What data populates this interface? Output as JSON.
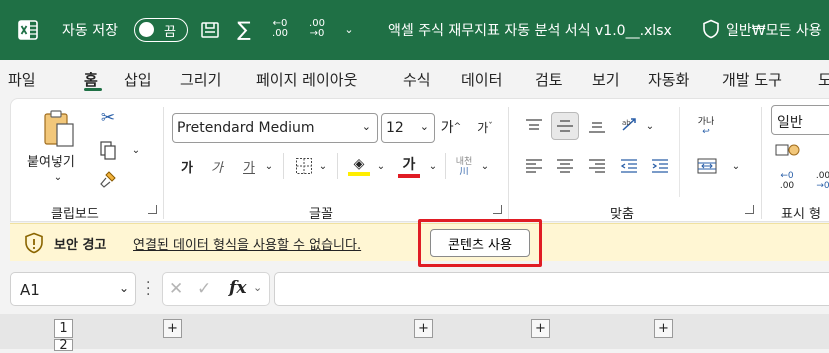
{
  "titlebar": {
    "autosave_label": "자동 저장",
    "autosave_state": "끔",
    "file_title": "액셀 주식 재무지표 자동 분석 서식 v1.0__.xlsx",
    "sensitivity": "일반₩모든 사용"
  },
  "tabs": [
    "파일",
    "홈",
    "삽입",
    "그리기",
    "페이지 레이아웃",
    "수식",
    "데이터",
    "검토",
    "보기",
    "자동화",
    "개발 도구",
    "도"
  ],
  "active_tab": "홈",
  "ribbon": {
    "clipboard": {
      "paste_label": "붙여넣기",
      "group_label": "클립보드"
    },
    "font": {
      "font_name": "Pretendard Medium",
      "font_size": "12",
      "group_label": "글꼴",
      "bold": "가",
      "italic": "가",
      "underline": "가",
      "font_color_glyph": "가",
      "phonetic": "내천"
    },
    "align": {
      "group_label": "맞춤",
      "wrap_glyph": "가나"
    },
    "number": {
      "format": "일반",
      "group_label": "표시 형"
    }
  },
  "message_bar": {
    "title": "보안 경고",
    "text": "연결된 데이터 형식을 사용할 수 없습니다.",
    "button": "콘텐츠 사용"
  },
  "formula_bar": {
    "name_box": "A1",
    "fx": "fx",
    "value": ""
  },
  "grid": {
    "outline_levels": [
      "1",
      "2"
    ],
    "expand_symbol": "+"
  },
  "colors": {
    "title_bg": "#1f7045",
    "accent": "#1f7045",
    "message_bg": "#fff6d3",
    "highlight": "#e01c24",
    "font_highlight": "#ffee00",
    "font_color": "#e01c24"
  }
}
